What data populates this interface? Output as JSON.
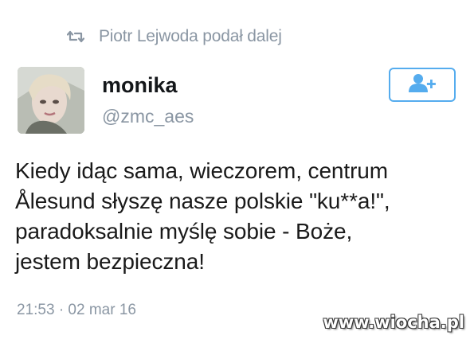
{
  "retweet": {
    "icon": "retweet-icon",
    "text": "Piotr Lejwoda podał dalej"
  },
  "user": {
    "name": "monika",
    "handle": "@zmc_aes",
    "avatar_icon": "avatar-photo"
  },
  "follow_button": {
    "icon": "follow-user-plus-icon",
    "accent_color": "#55acee"
  },
  "tweet": {
    "lines": [
      "Kiedy idąc sama, wieczorem, centrum",
      "Ålesund słyszę nasze polskie \"ku**a!\",",
      "paradoksalnie myślę sobie - Boże,",
      "jestem bezpieczna!"
    ],
    "timestamp": "21:53 · 02 mar 16"
  },
  "watermark": {
    "text": "www.wiocha.pl"
  }
}
